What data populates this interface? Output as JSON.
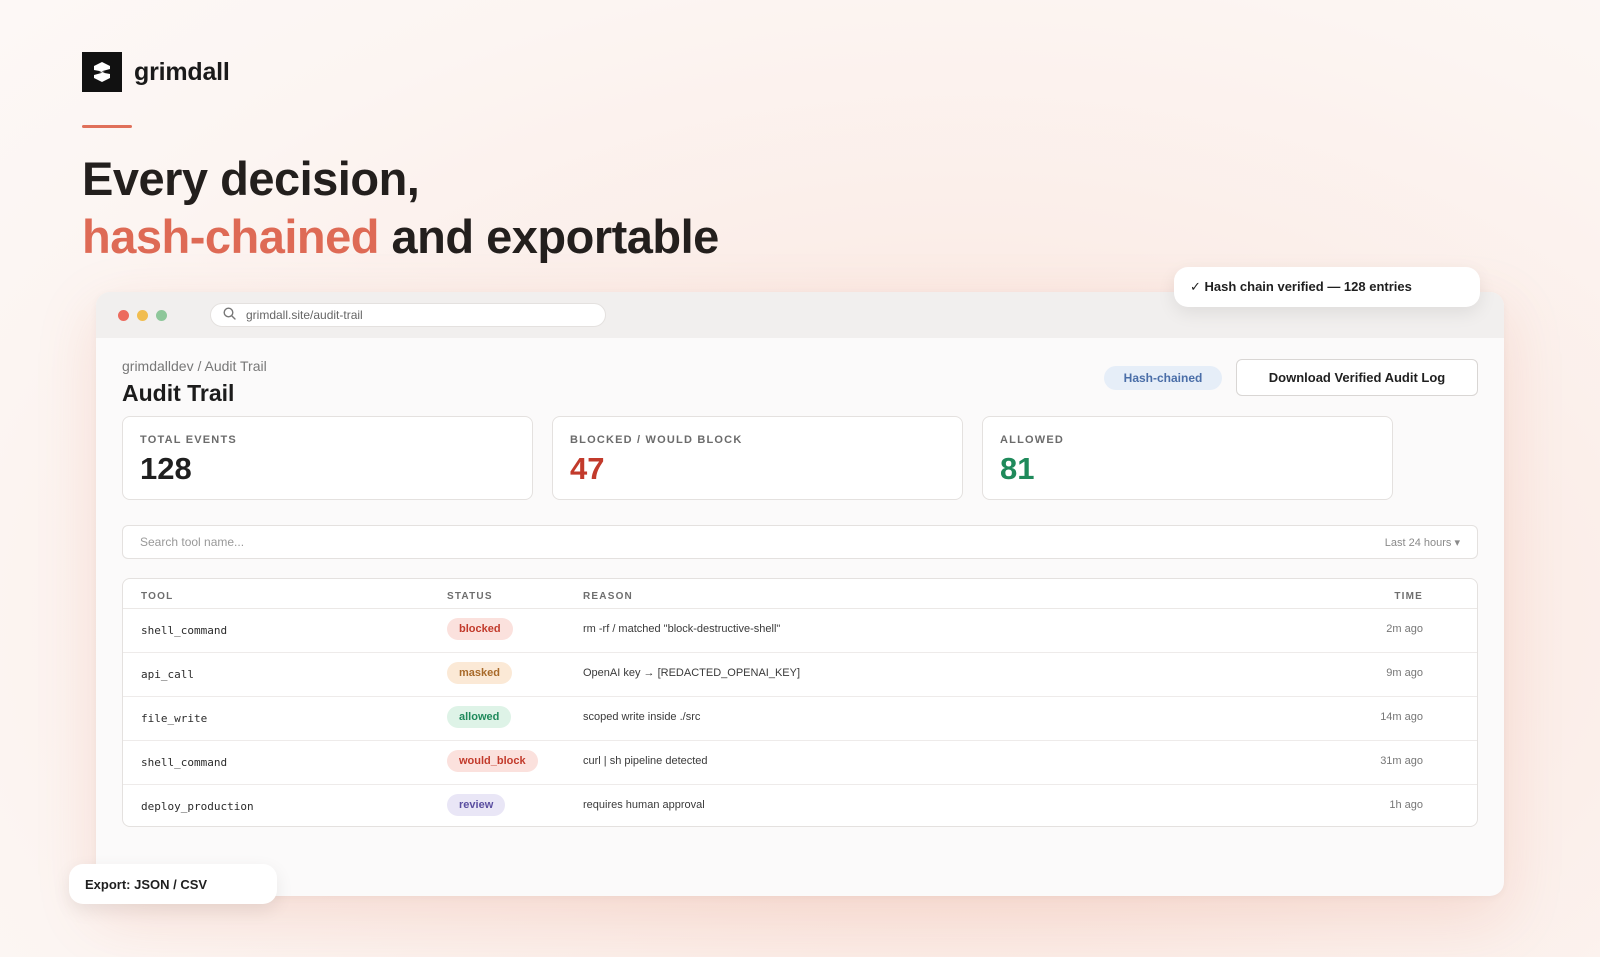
{
  "brand": {
    "name": "grimdall"
  },
  "headline": {
    "line1": "Every decision,",
    "highlight": "hash-chained",
    "rest": "and exportable"
  },
  "browser": {
    "url": "grimdall.site/audit-trail"
  },
  "page": {
    "breadcrumb": "grimdalldev / Audit Trail",
    "title": "Audit Trail",
    "chip": "Hash-chained",
    "download_label": "Download Verified Audit Log"
  },
  "stats": [
    {
      "label": "TOTAL EVENTS",
      "value": "128",
      "color": "#1f1f1f"
    },
    {
      "label": "BLOCKED / WOULD BLOCK",
      "value": "47",
      "color": "#c23a2b"
    },
    {
      "label": "ALLOWED",
      "value": "81",
      "color": "#1f8a5b"
    }
  ],
  "search": {
    "placeholder": "Search tool name...",
    "range": "Last 24 hours ▾"
  },
  "table": {
    "headers": {
      "tool": "TOOL",
      "status": "STATUS",
      "reason": "REASON",
      "time": "TIME"
    },
    "rows": [
      {
        "tool": "shell_command",
        "status": "blocked",
        "reason": "rm -rf / matched \"block-destructive-shell\"",
        "time": "2m ago"
      },
      {
        "tool": "api_call",
        "status": "masked",
        "reason": "OpenAI key → [REDACTED_OPENAI_KEY]",
        "time": "9m ago"
      },
      {
        "tool": "file_write",
        "status": "allowed",
        "reason": "scoped write inside ./src",
        "time": "14m ago"
      },
      {
        "tool": "shell_command",
        "status": "would_block",
        "reason": "curl | sh pipeline detected",
        "time": "31m ago"
      },
      {
        "tool": "deploy_production",
        "status": "review",
        "reason": "requires human approval",
        "time": "1h ago"
      }
    ]
  },
  "status_colors": {
    "blocked": {
      "bg": "#fbe1dd",
      "fg": "#c23a2b"
    },
    "masked": {
      "bg": "#fbe9d6",
      "fg": "#a86a2a"
    },
    "allowed": {
      "bg": "#def3e7",
      "fg": "#1f8a5b"
    },
    "would_block": {
      "bg": "#fbe1dd",
      "fg": "#c23a2b"
    },
    "review": {
      "bg": "#e9e6f6",
      "fg": "#5a4ea0"
    }
  },
  "toasts": {
    "verified": "✓ Hash chain verified — 128 entries",
    "export": "Export: JSON / CSV"
  }
}
